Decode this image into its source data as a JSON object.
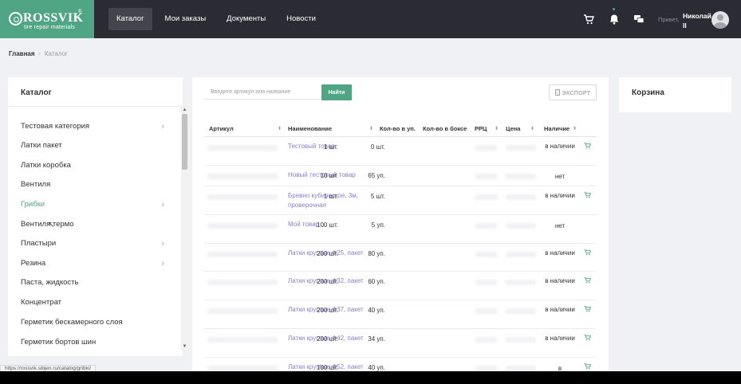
{
  "brand": {
    "name": "ROSSVIK",
    "reg": "®",
    "subtitle": "tire repair materials",
    "color": "#4fa584"
  },
  "nav": [
    {
      "label": "Каталог",
      "active": true
    },
    {
      "label": "Мои заказы"
    },
    {
      "label": "Документы"
    },
    {
      "label": "Новости"
    }
  ],
  "user": {
    "greeting": "Привет,",
    "name": "Николай II"
  },
  "breadcrumb": {
    "home": "Главная",
    "current": "Каталог"
  },
  "catalog": {
    "title": "Каталог",
    "items": [
      {
        "label": "Тестовая категория",
        "chevron": "›"
      },
      {
        "label": "Латки пакет"
      },
      {
        "label": "Латки коробка"
      },
      {
        "label": "Вентиля"
      },
      {
        "label": "Грибки",
        "chevron": "›",
        "active": true
      },
      {
        "label": "Вентиля термо"
      },
      {
        "label": "Пластыри",
        "chevron": "›"
      },
      {
        "label": "Резина",
        "chevron": "›"
      },
      {
        "label": "Паста, жидкость"
      },
      {
        "label": "Концентрат"
      },
      {
        "label": "Герметик бескамерного слоя"
      },
      {
        "label": "Герметик бортов шин"
      }
    ]
  },
  "search": {
    "placeholder": "Введите артикул или название",
    "button": "Найти",
    "export": "ЭКСПОРТ"
  },
  "table": {
    "headers": {
      "sku": "Артикул",
      "name": "Наименование",
      "qty": "Кол-во в уп.",
      "box": "Кол-во в боксе",
      "rrp": "РРЦ",
      "price": "Цена",
      "avail": "Наличие"
    },
    "rows": [
      {
        "name": "Тестовый товар",
        "qty": "1 шт.",
        "box": "0 шт.",
        "avail": "в наличии",
        "cart": true
      },
      {
        "name": "Новый тестовый товар",
        "qty": "10 шт.",
        "box": "65 уп.",
        "avail": "нет",
        "cart": false
      },
      {
        "name": "Бревно кубическое, 3м, проверочная",
        "qty": "1 шт.",
        "box": "5 шт.",
        "avail": "в наличии",
        "cart": true
      },
      {
        "name": "Мой товар",
        "qty": "100 шт.",
        "box": "5 уп.",
        "avail": "нет",
        "cart": false
      },
      {
        "name": "Латки круглые Ф25, пакет",
        "qty": "200 шт.",
        "box": "80 уп.",
        "avail": "в наличии",
        "cart": true
      },
      {
        "name": "Латки круглые Ф32, пакет",
        "qty": "200 шт.",
        "box": "60 уп.",
        "avail": "в наличии",
        "cart": true
      },
      {
        "name": "Латки круглые Ф37, пакет",
        "qty": "200 шт.",
        "box": "40 уп.",
        "avail": "в наличии",
        "cart": true
      },
      {
        "name": "Латки круглые Ф42, пакет",
        "qty": "200 шт.",
        "box": "34 уп.",
        "avail": "в наличии",
        "cart": true
      },
      {
        "name": "Латки круглые Ф52, пакет",
        "qty": "100 шт.",
        "box": "40 уп.",
        "avail": "в",
        "cart": true
      }
    ]
  },
  "cart": {
    "title": "Корзина"
  },
  "status_url": "https://rossvik.sibjen.ru/catalog/gribki/"
}
